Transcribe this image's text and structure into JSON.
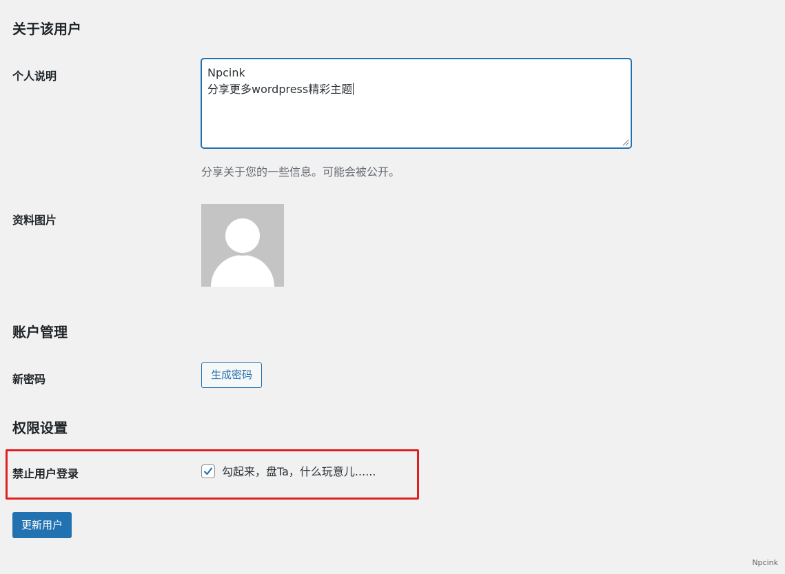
{
  "about": {
    "title": "关于该用户",
    "bio_label": "个人说明",
    "bio_lines": [
      "Npcink",
      "分享更多wordpress精彩主题"
    ],
    "bio_description": "分享关于您的一些信息。可能会被公开。",
    "avatar_label": "资料图片"
  },
  "account": {
    "title": "账户管理",
    "password_label": "新密码",
    "generate_button": "生成密码"
  },
  "permissions": {
    "title": "权限设置",
    "disable_login_label": "禁止用户登录",
    "checkbox_checked": true,
    "checkbox_text": "勾起来，盘Ta，什么玩意儿......",
    "highlight_color": "#e02020"
  },
  "submit": {
    "label": "更新用户"
  },
  "watermark": "Npcink",
  "colors": {
    "accent": "#2271b1",
    "background": "#f1f1f1"
  }
}
